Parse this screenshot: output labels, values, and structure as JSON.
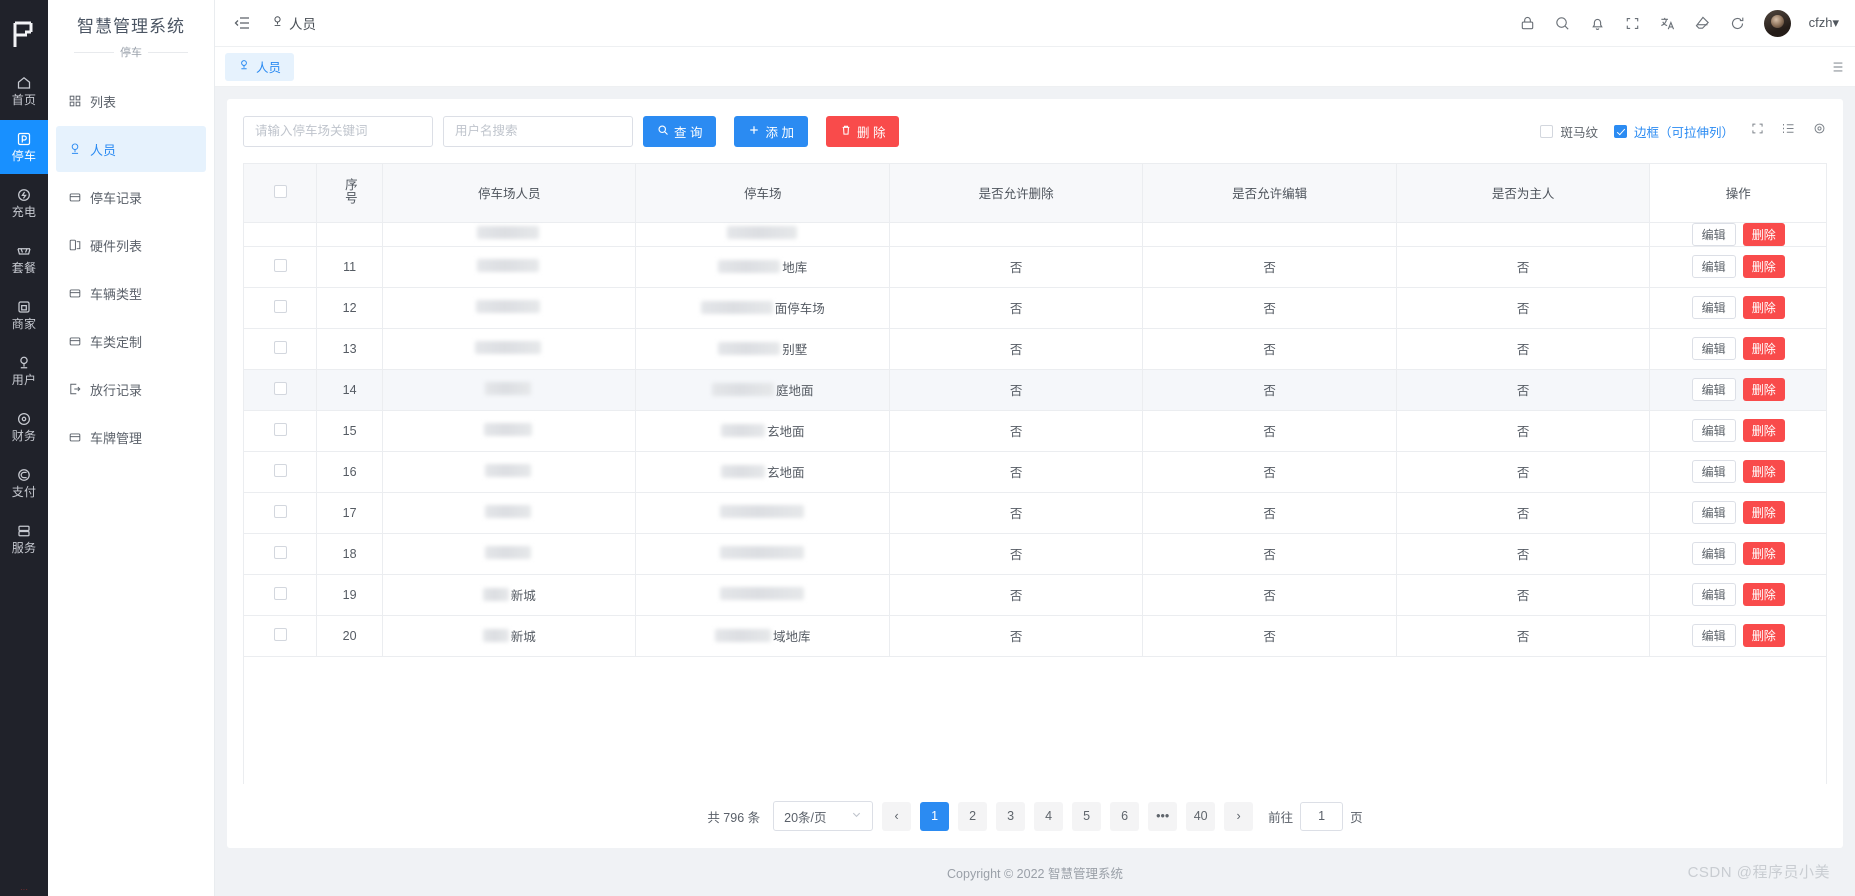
{
  "rail": {
    "logo_icon": "brand-logo-icon",
    "items": [
      {
        "label": "首页",
        "icon": "home-icon",
        "active": false
      },
      {
        "label": "停车",
        "icon": "parking-icon",
        "active": true
      },
      {
        "label": "充电",
        "icon": "charging-icon",
        "active": false
      },
      {
        "label": "套餐",
        "icon": "vip-package-icon",
        "active": false
      },
      {
        "label": "商家",
        "icon": "merchant-icon",
        "active": false
      },
      {
        "label": "用户",
        "icon": "user-icon",
        "active": false
      },
      {
        "label": "财务",
        "icon": "finance-icon",
        "active": false
      },
      {
        "label": "支付",
        "icon": "payment-icon",
        "active": false
      },
      {
        "label": "服务",
        "icon": "service-icon",
        "active": false
      }
    ]
  },
  "sidebar": {
    "title": "智慧管理系统",
    "subtitle": "停车",
    "items": [
      {
        "label": "列表",
        "icon": "grid-icon",
        "active": false
      },
      {
        "label": "人员",
        "icon": "person-icon",
        "active": true
      },
      {
        "label": "停车记录",
        "icon": "record-icon",
        "active": false
      },
      {
        "label": "硬件列表",
        "icon": "device-icon",
        "active": false
      },
      {
        "label": "车辆类型",
        "icon": "car-type-icon",
        "active": false
      },
      {
        "label": "车类定制",
        "icon": "car-custom-icon",
        "active": false
      },
      {
        "label": "放行记录",
        "icon": "release-icon",
        "active": false
      },
      {
        "label": "车牌管理",
        "icon": "plate-icon",
        "active": false
      }
    ]
  },
  "topbar": {
    "collapse_icon": "collapse-menu-icon",
    "breadcrumb": "人员",
    "breadcrumb_icon": "person-icon",
    "icons": [
      "lock-icon",
      "search-icon",
      "bell-icon",
      "fullscreen-icon",
      "translate-icon",
      "theme-palette-icon",
      "refresh-icon"
    ],
    "avatar_name": "avatar",
    "username": "cfzh",
    "username_caret": "▾"
  },
  "tabbar": {
    "tabs": [
      {
        "label": "人员",
        "icon": "person-icon",
        "active": true
      }
    ],
    "more_icon": "tab-options-icon"
  },
  "toolbar": {
    "keyword_placeholder": "请输入停车场关键词",
    "keyword_value": "",
    "username_placeholder": "用户名搜索",
    "username_value": "",
    "search_label": "查 询",
    "add_label": "添 加",
    "delete_label": "删 除",
    "zebra_label": "斑马纹",
    "zebra_checked": false,
    "border_label": "边框（可拉伸列）",
    "border_checked": true,
    "icons": [
      "fullscreen-icon",
      "column-settings-icon",
      "gear-icon"
    ],
    "accent_color": "#2b8bf2",
    "danger_color": "#f94b4b"
  },
  "table": {
    "columns": [
      {
        "key": "select",
        "label": ""
      },
      {
        "key": "index",
        "label": "序号"
      },
      {
        "key": "person",
        "label": "停车场人员"
      },
      {
        "key": "lot",
        "label": "停车场"
      },
      {
        "key": "allow_delete",
        "label": "是否允许删除"
      },
      {
        "key": "allow_edit",
        "label": "是否允许编辑"
      },
      {
        "key": "is_owner",
        "label": "是否为主人"
      },
      {
        "key": "actions",
        "label": "操作"
      }
    ],
    "edit_label": "编辑",
    "delete_label": "删除",
    "rows": [
      {
        "index": "",
        "person_redact": 62,
        "person_suffix": "",
        "lot_redact": 70,
        "lot_suffix": "",
        "allow_delete": "",
        "allow_edit": "",
        "is_owner": "",
        "clipped": true,
        "highlight": false
      },
      {
        "index": "11",
        "person_redact": 62,
        "person_suffix": "",
        "lot_redact": 62,
        "lot_suffix": "地库",
        "allow_delete": "否",
        "allow_edit": "否",
        "is_owner": "否",
        "clipped": false,
        "highlight": false
      },
      {
        "index": "12",
        "person_redact": 64,
        "person_suffix": "",
        "lot_redact": 72,
        "lot_suffix": "面停车场",
        "allow_delete": "否",
        "allow_edit": "否",
        "is_owner": "否",
        "clipped": false,
        "highlight": false
      },
      {
        "index": "13",
        "person_redact": 66,
        "person_suffix": "",
        "lot_redact": 62,
        "lot_suffix": "别墅",
        "allow_delete": "否",
        "allow_edit": "否",
        "is_owner": "否",
        "clipped": false,
        "highlight": false
      },
      {
        "index": "14",
        "person_redact": 46,
        "person_suffix": "",
        "lot_redact": 62,
        "lot_suffix": "庭地面",
        "allow_delete": "否",
        "allow_edit": "否",
        "is_owner": "否",
        "clipped": false,
        "highlight": true
      },
      {
        "index": "15",
        "person_redact": 48,
        "person_suffix": "",
        "lot_redact": 44,
        "lot_suffix": "玄地面",
        "allow_delete": "否",
        "allow_edit": "否",
        "is_owner": "否",
        "clipped": false,
        "highlight": false
      },
      {
        "index": "16",
        "person_redact": 46,
        "person_suffix": "",
        "lot_redact": 44,
        "lot_suffix": "玄地面",
        "allow_delete": "否",
        "allow_edit": "否",
        "is_owner": "否",
        "clipped": false,
        "highlight": false
      },
      {
        "index": "17",
        "person_redact": 46,
        "person_suffix": "",
        "lot_redact": 84,
        "lot_suffix": "",
        "allow_delete": "否",
        "allow_edit": "否",
        "is_owner": "否",
        "clipped": false,
        "highlight": false
      },
      {
        "index": "18",
        "person_redact": 46,
        "person_suffix": "",
        "lot_redact": 84,
        "lot_suffix": "",
        "allow_delete": "否",
        "allow_edit": "否",
        "is_owner": "否",
        "clipped": false,
        "highlight": false
      },
      {
        "index": "19",
        "person_redact": 26,
        "person_suffix": "新城",
        "lot_redact": 84,
        "lot_suffix": "",
        "allow_delete": "否",
        "allow_edit": "否",
        "is_owner": "否",
        "clipped": false,
        "highlight": false
      },
      {
        "index": "20",
        "person_redact": 26,
        "person_suffix": "新城",
        "lot_redact": 56,
        "lot_suffix": "域地库",
        "allow_delete": "否",
        "allow_edit": "否",
        "is_owner": "否",
        "clipped": false,
        "highlight": false
      }
    ]
  },
  "pagination": {
    "total_text": "共 796 条",
    "page_size": "20条/页",
    "prev": "‹",
    "next": "›",
    "pages": [
      "1",
      "2",
      "3",
      "4",
      "5",
      "6",
      "•••",
      "40"
    ],
    "current": "1",
    "jump_prefix": "前往",
    "jump_value": "1",
    "jump_suffix": "页"
  },
  "footer": {
    "copyright": "Copyright © 2022 智慧管理系统"
  },
  "watermark": {
    "text": "CSDN @程序员小美"
  }
}
